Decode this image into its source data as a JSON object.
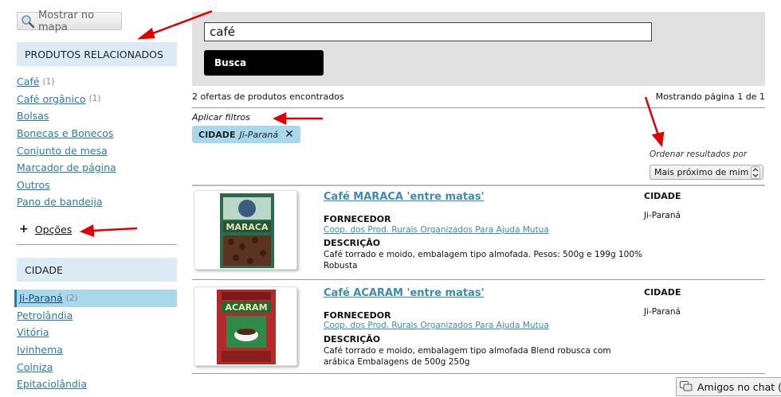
{
  "sidebar": {
    "map_button": "Mostrar no mapa",
    "related_heading": "PRODUTOS RELACIONADOS",
    "related_items": [
      {
        "label": "Café",
        "count": "(1)"
      },
      {
        "label": "Café orgânico",
        "count": "(1)"
      },
      {
        "label": "Bolsas",
        "count": ""
      },
      {
        "label": "Bonecas e Bonecos",
        "count": ""
      },
      {
        "label": "Conjunto de mesa",
        "count": ""
      },
      {
        "label": "Marcador de página",
        "count": ""
      },
      {
        "label": "Outros",
        "count": ""
      },
      {
        "label": "Pano de bandeija",
        "count": ""
      }
    ],
    "options_plus": "+",
    "options_label": "Opções",
    "city_heading": "CIDADE",
    "city_items": [
      {
        "label": "Ji-Paraná",
        "count": "(2)"
      },
      {
        "label": "Petrolândia",
        "count": ""
      },
      {
        "label": "Vitória",
        "count": ""
      },
      {
        "label": "Ivinhema",
        "count": ""
      },
      {
        "label": "Colniza",
        "count": ""
      },
      {
        "label": "Epitaciolândia",
        "count": ""
      }
    ]
  },
  "search": {
    "query": "café",
    "button": "Busca"
  },
  "results": {
    "count_text": "2 ofertas de produtos encontrados",
    "page_text": "Mostrando página 1 de 1",
    "apply_filters": "Aplicar filtros",
    "filter_key": "CIDADE",
    "filter_value": "Ji-Paraná",
    "filter_remove": "✕",
    "sort_label": "Ordenar resultados por",
    "sort_value": "Mais próximo de mim",
    "products": [
      {
        "title": "Café MARACA 'entre matas'",
        "supplier_label": "FORNECEDOR",
        "supplier": "Coop. dos Prod. Rurais Organizados Para Ajuda Mutua",
        "desc_label": "DESCRIÇÃO",
        "description": "Café torrado e moido, embalagem tipo almofada. Pesos: 500g e 199g 100% Robusta",
        "city_label": "CIDADE",
        "city": "Ji-Paraná",
        "package_text": "MARACA"
      },
      {
        "title": "Café ACARAM 'entre matas'",
        "supplier_label": "FORNECEDOR",
        "supplier": "Coop. dos Prod. Rurais Organizados Para Ajuda Mutua",
        "desc_label": "DESCRIÇÃO",
        "description": "Café torrado e moido, embalagem tipo almofada Blend robusca com arábica Embalagens de 500g 250g",
        "city_label": "CIDADE",
        "city": "Ji-Paraná",
        "package_text": "ACARAM"
      }
    ]
  },
  "chat": {
    "label": "Amigos no chat (0"
  },
  "colors": {
    "link": "#2a7aa8",
    "heading_bg": "#dbeaf5",
    "active_bg": "#a9d8ec",
    "annotation_arrow": "#e00000"
  }
}
